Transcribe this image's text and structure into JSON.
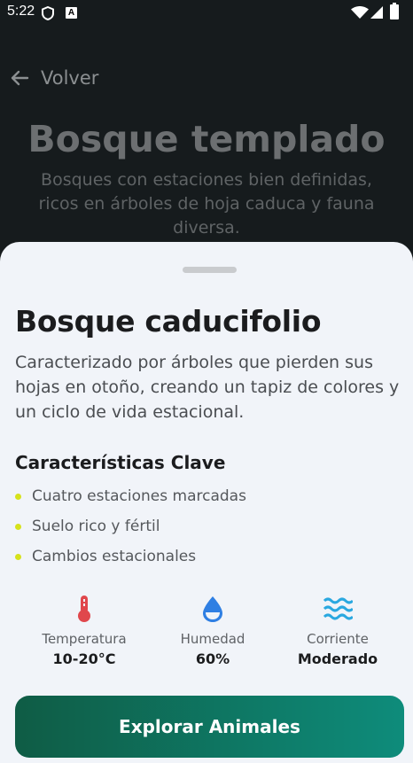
{
  "status_bar": {
    "time": "5:22",
    "a_badge": "A"
  },
  "header": {
    "back_label": "Volver"
  },
  "biome": {
    "title": "Bosque templado",
    "description": "Bosques con estaciones bien definidas, ricos en árboles de hoja caduca y fauna diversa."
  },
  "sheet": {
    "title": "Bosque caducifolio",
    "description": "Caracterizado por árboles que pierden sus hojas en otoño, creando un tapiz de colores y un ciclo de vida estacional.",
    "features_title": "Características Clave",
    "features": [
      "Cuatro estaciones marcadas",
      "Suelo rico y fértil",
      "Cambios estacionales"
    ],
    "stats": [
      {
        "icon": "thermometer-icon",
        "label": "Temperatura",
        "value": "10-20°C",
        "color": "#e0474c"
      },
      {
        "icon": "water-drop-icon",
        "label": "Humedad",
        "value": "60%",
        "color": "#2f7fe3"
      },
      {
        "icon": "waves-icon",
        "label": "Corriente",
        "value": "Moderado",
        "color": "#2aa8e0"
      }
    ],
    "cta_label": "Explorar Animales"
  },
  "colors": {
    "bullet": "#d6e21b",
    "cta_gradient_start": "#0f5c45",
    "cta_gradient_end": "#0e8c7b",
    "sheet_bg": "#f1f4f9"
  }
}
